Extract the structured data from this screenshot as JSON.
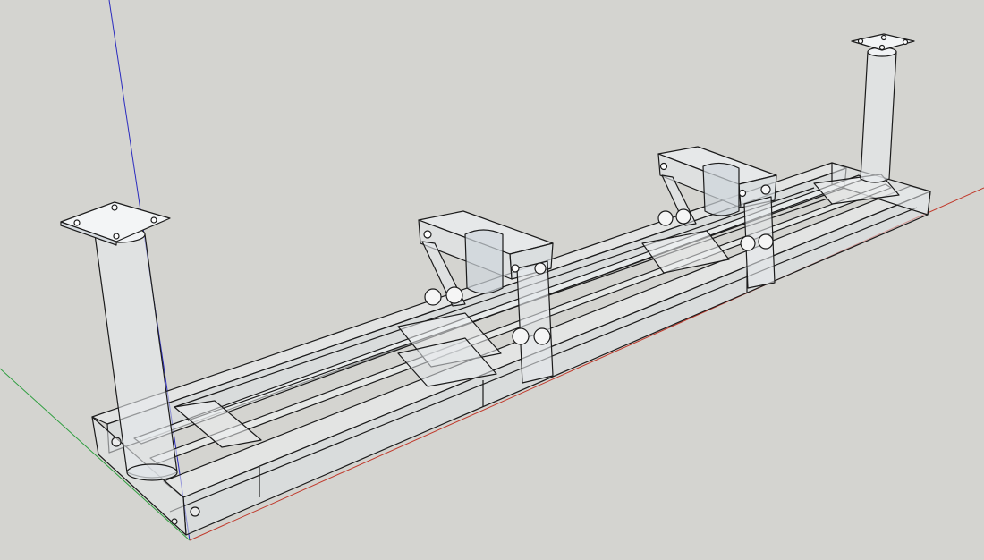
{
  "viewport": {
    "background": "#d4d4d0",
    "render_mode": "x-ray",
    "model": "steel-frame-assembly"
  },
  "axes": [
    {
      "name": "red-axis",
      "color": "#c0392b"
    },
    {
      "name": "green-axis",
      "color": "#2e9e3f"
    },
    {
      "name": "blue-axis",
      "color": "#2b2bbf"
    }
  ],
  "components": [
    {
      "name": "base-frame",
      "kind": "beam-frame"
    },
    {
      "name": "left-column-post",
      "kind": "round-column"
    },
    {
      "name": "right-column-post",
      "kind": "round-column"
    },
    {
      "name": "left-saddle-bracket",
      "kind": "saddle-with-pulleys"
    },
    {
      "name": "right-saddle-bracket",
      "kind": "saddle-with-pulleys"
    }
  ],
  "colors": {
    "edge": "#1b1b1b",
    "steel_fill": "#e8ecef",
    "steel_shade": "#b9bfc4",
    "glass_tint": "#dfe4ea"
  }
}
